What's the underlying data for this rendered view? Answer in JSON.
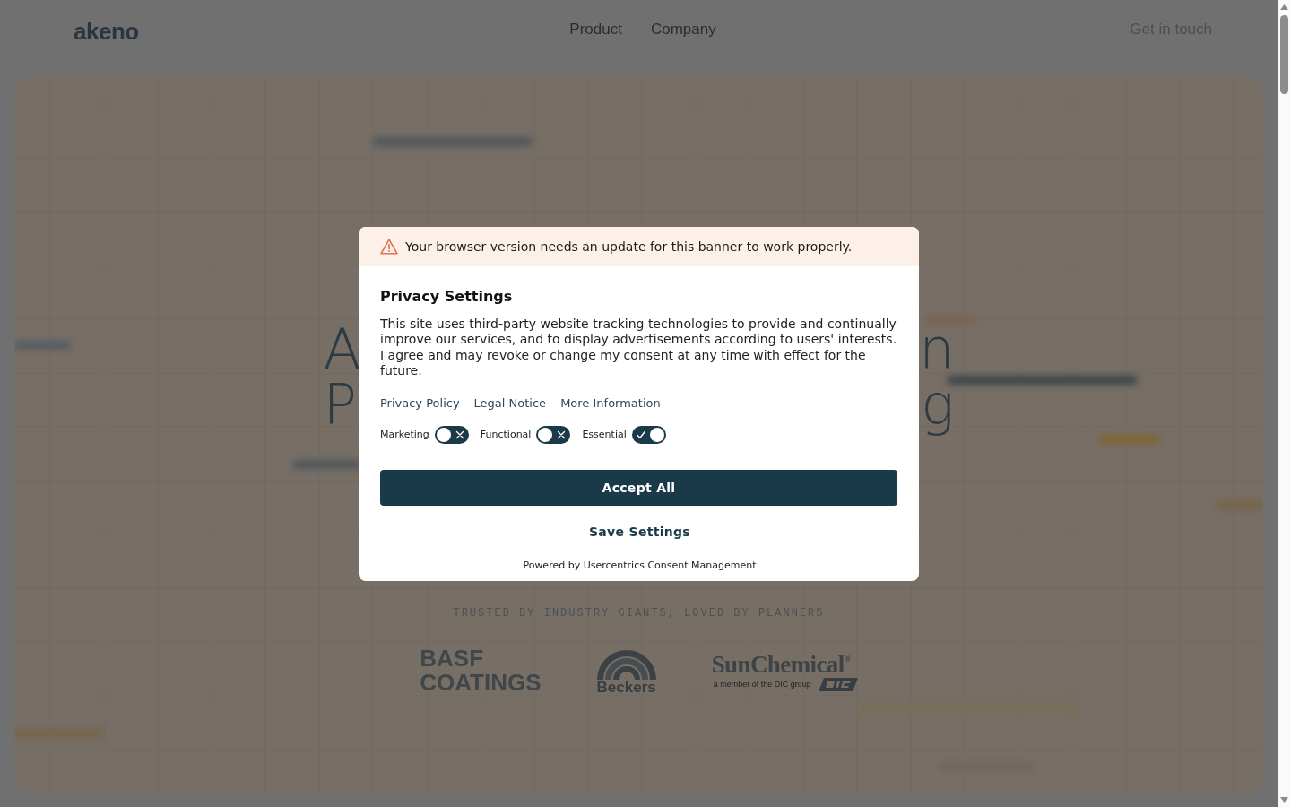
{
  "header": {
    "logo": "akeno",
    "nav": [
      {
        "label": "Product"
      },
      {
        "label": "Company"
      }
    ],
    "cta": "Get in touch"
  },
  "hero": {
    "heading_fragments": [
      {
        "left": "A",
        "right": "n"
      },
      {
        "left": "P",
        "right": "g"
      }
    ],
    "trusted_caption": "TRUSTED BY INDUSTRY GIANTS, LOVED BY PLANNERS",
    "logos": [
      {
        "kind": "wordmark",
        "lines": [
          "BASF",
          "COATINGS"
        ]
      },
      {
        "kind": "arch",
        "name": "Beckers"
      },
      {
        "kind": "serif",
        "name": "SunChemical$^{®}$",
        "tagline": "a member of the DIC group"
      }
    ]
  },
  "consent_dialog": {
    "warning": "Your browser version needs an update for this banner to work properly.",
    "title": "Privacy Settings",
    "body": "This site uses third-party website tracking technologies to provide and continually improve our services, and to display advertisements according to users' interests. I agree and may revoke or change my consent at any time with effect for the future.",
    "links": [
      "Privacy Policy",
      "Legal Notice",
      "More Information"
    ],
    "toggles": [
      {
        "label": "Marketing",
        "checked": false
      },
      {
        "label": "Functional",
        "checked": false
      },
      {
        "label": "Essential",
        "checked": true
      }
    ],
    "buttons": [
      {
        "kind": "primary",
        "label": "Accept All"
      },
      {
        "kind": "text",
        "label": "Save Settings"
      }
    ],
    "footer": "Powered by Usercentrics Consent Management"
  }
}
